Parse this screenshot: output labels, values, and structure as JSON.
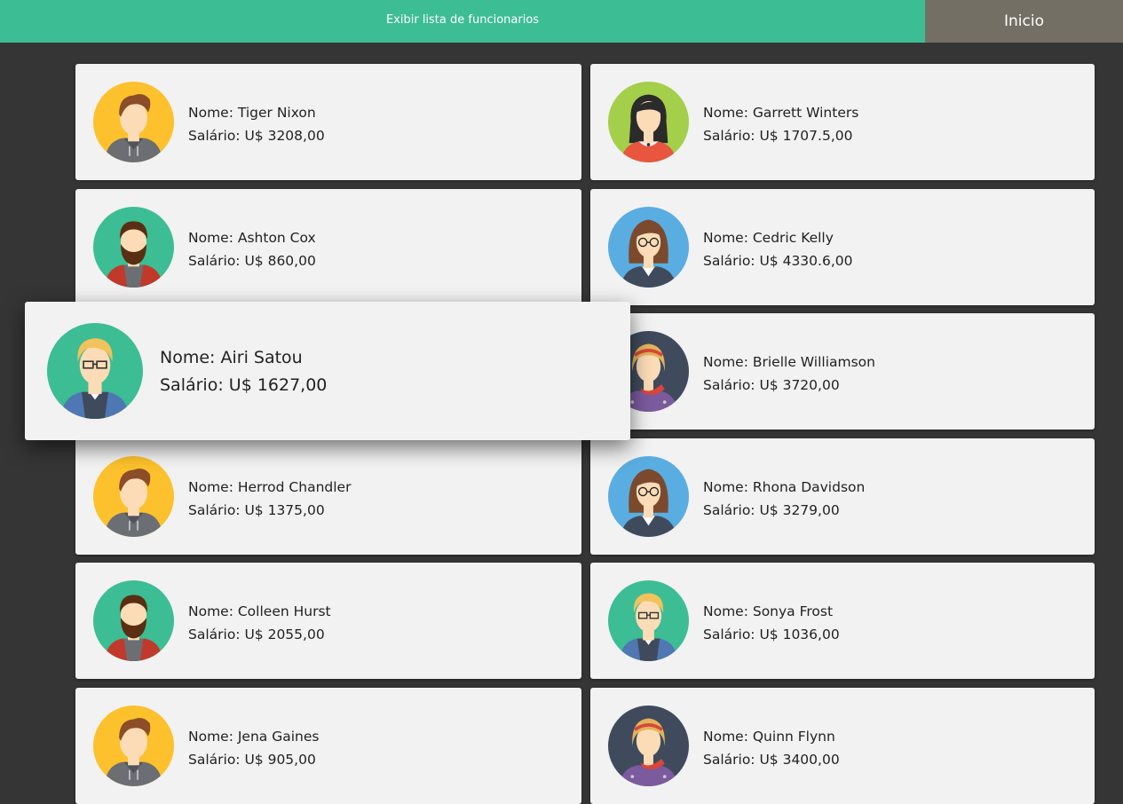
{
  "header": {
    "list_label": "Exibir lista de funcionarios",
    "home_label": "Inicio"
  },
  "employees": [
    {
      "name": "Nome: Tiger Nixon",
      "salary": "Salário: U$ 3208,00",
      "avatar": "man-hoodie-avatar-icon",
      "bg": "#fcc12c"
    },
    {
      "name": "Nome: Garrett Winters",
      "salary": "Salário: U$ 1707.5,00",
      "avatar": "woman-dark-hair-avatar-icon",
      "bg": "#a3cf4a"
    },
    {
      "name": "Nome: Ashton Cox",
      "salary": "Salário: U$ 860,00",
      "avatar": "bearded-man-avatar-icon",
      "bg": "#3dbd93"
    },
    {
      "name": "Nome: Cedric Kelly",
      "salary": "Salário: U$ 4330.6,00",
      "avatar": "woman-glasses-avatar-icon",
      "bg": "#5aade0"
    },
    {
      "name": "Nome: Airi Satou",
      "salary": "Salário: U$ 1627,00",
      "avatar": "man-glasses-avatar-icon",
      "bg": "#3dbd93"
    },
    {
      "name": "Nome: Brielle Williamson",
      "salary": "Salário: U$ 3720,00",
      "avatar": "woman-headband-avatar-icon",
      "bg": "#3f4a5c"
    },
    {
      "name": "Nome: Herrod Chandler",
      "salary": "Salário: U$ 1375,00",
      "avatar": "man-hoodie-avatar-icon",
      "bg": "#fcc12c"
    },
    {
      "name": "Nome: Rhona Davidson",
      "salary": "Salário: U$ 3279,00",
      "avatar": "woman-glasses-avatar-icon",
      "bg": "#5aade0"
    },
    {
      "name": "Nome: Colleen Hurst",
      "salary": "Salário: U$ 2055,00",
      "avatar": "bearded-man-avatar-icon",
      "bg": "#3dbd93"
    },
    {
      "name": "Nome: Sonya Frost",
      "salary": "Salário: U$ 1036,00",
      "avatar": "man-glasses-avatar-icon",
      "bg": "#3dbd93"
    },
    {
      "name": "Nome: Jena Gaines",
      "salary": "Salário: U$ 905,00",
      "avatar": "man-hoodie-avatar-icon",
      "bg": "#fcc12c"
    },
    {
      "name": "Nome: Quinn Flynn",
      "salary": "Salário: U$ 3400,00",
      "avatar": "woman-headband-avatar-icon",
      "bg": "#3f4a5c"
    }
  ]
}
